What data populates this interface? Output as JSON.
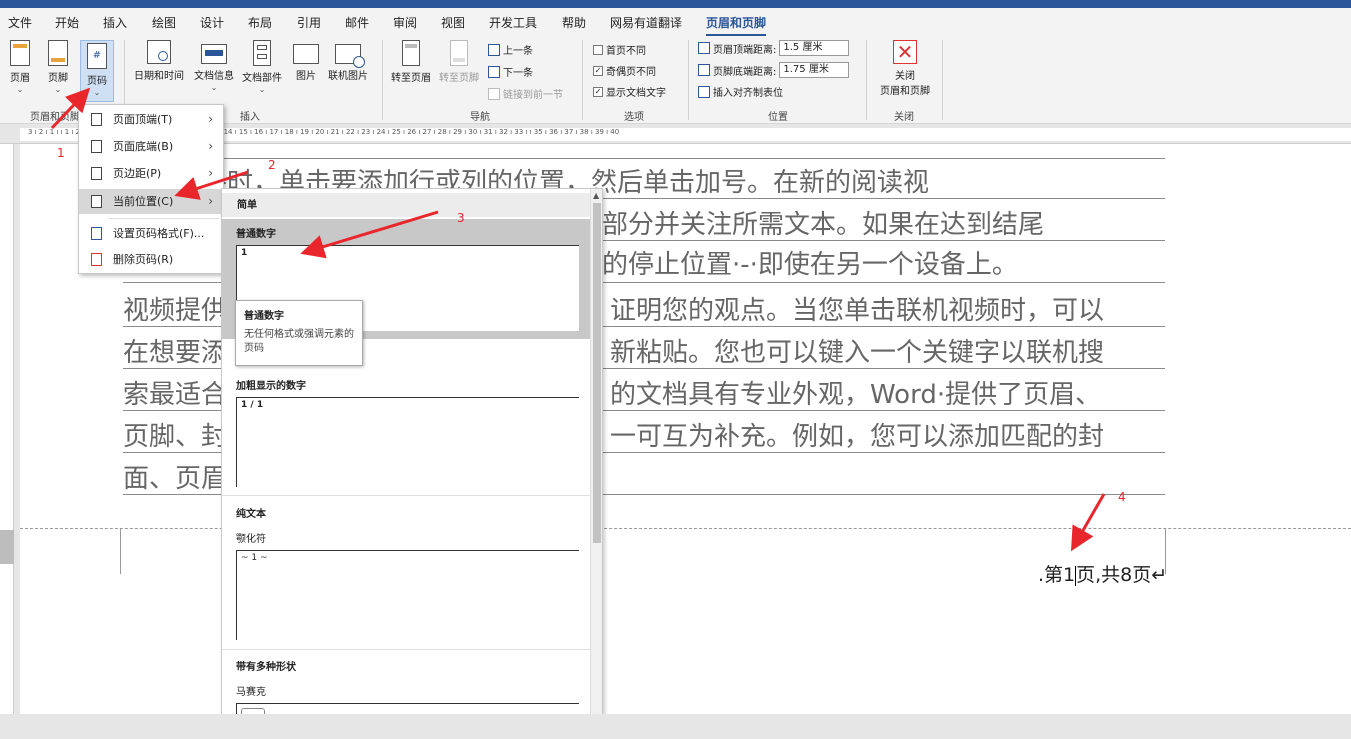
{
  "menu": {
    "tabs": [
      "文件",
      "开始",
      "插入",
      "绘图",
      "设计",
      "布局",
      "引用",
      "邮件",
      "审阅",
      "视图",
      "开发工具",
      "帮助",
      "网易有道翻译",
      "页眉和页脚"
    ],
    "active": "页眉和页脚"
  },
  "ribbon": {
    "header_label": "页眉",
    "footer_label": "页脚",
    "page_number_label": "页码",
    "group_hf": "页眉和页脚",
    "datetime_label": "日期和时间",
    "docinfo_label": "文档信息",
    "docparts_label": "文档部件",
    "picture_label": "图片",
    "online_picture_label": "联机图片",
    "group_insert": "插入",
    "goto_header_label": "转至页眉",
    "goto_footer_label": "转至页脚",
    "prev_label": "上一条",
    "next_label": "下一条",
    "link_prev_label": "链接到前一节",
    "group_nav": "导航",
    "first_page_diff": "首页不同",
    "odd_even_diff": "奇偶页不同",
    "show_doc_text": "显示文档文字",
    "group_options": "选项",
    "header_top_label": "页眉顶端距离:",
    "header_top_value": "1.5 厘米",
    "footer_bottom_label": "页脚底端距离:",
    "footer_bottom_value": "1.75 厘米",
    "insert_align_tab": "插入对齐制表位",
    "group_position": "位置",
    "close_label_1": "关闭",
    "close_label_2": "页眉和页脚",
    "group_close": "关闭"
  },
  "ruler": {
    "ticks": "3 ı 2 ı 1 ı   ı 1 ı 2 ı 3 ı 4 ı 5 ı 6 ı 7 ı 8 ı 9 ı 10 ı 11 ı 12 ı 13 ı 14 ı 15 ı 16 ı 17 ı 18 ı 19 ı 20 ı 21 ı 22 ı 23 ı 24 ı 25 ı 26 ı 27 ı 28 ı 29 ı 30 ı 31 ı 32 ı 33 ı   ı 35 ı 36 ı 37 ı 38 ı 39 ı 40"
  },
  "document": {
    "lines": [
      "",
      "处理表格时，单击要添加行或列的位置，然后单击加号。在新的阅读视",
      "某些部分并关注所需文本。如果在达到结尾",
      "在您的停止位置·-·即使在另一个设备上。",
      "视频提供",
      "在想要添",
      "索最适合",
      "页脚、封",
      "面、页眉"
    ],
    "lines_right": [
      "",
      "",
      "",
      "",
      "证明您的观点。当您单击联机视频时，可以",
      "新粘贴。您也可以键入一个关键字以联机搜",
      "的文档具有专业外观，Word·提供了页眉、",
      "一可互为补充。例如，您可以添加匹配的封",
      ""
    ],
    "footer_before_cursor": ".第1",
    "footer_after_cursor": "页,共8页↵"
  },
  "dropdown": {
    "items": [
      {
        "label": "页面顶端(T)"
      },
      {
        "label": "页面底端(B)"
      },
      {
        "label": "页边距(P)"
      },
      {
        "label": "当前位置(C)"
      },
      {
        "label": "设置页码格式(F)..."
      },
      {
        "label": "删除页码(R)"
      }
    ]
  },
  "gallery": {
    "head_simple": "简单",
    "plain_number": "普通数字",
    "plain_sample": "1",
    "bold_number": "加粗显示的数字",
    "bold_sample": "1 / 1",
    "plain_text": "纯文本",
    "tilde": "颚化符",
    "tilde_sample": "~ 1 ~",
    "shapes_head": "带有多种形状",
    "mosaic": "马赛克"
  },
  "tooltip": {
    "title": "普通数字",
    "desc": "无任何格式或强调元素的页码"
  },
  "annotations": {
    "n1": "1",
    "n2": "2",
    "n3": "3",
    "n4": "4"
  },
  "colors": {
    "accent": "#2b579a",
    "annotation": "#e8262b"
  }
}
